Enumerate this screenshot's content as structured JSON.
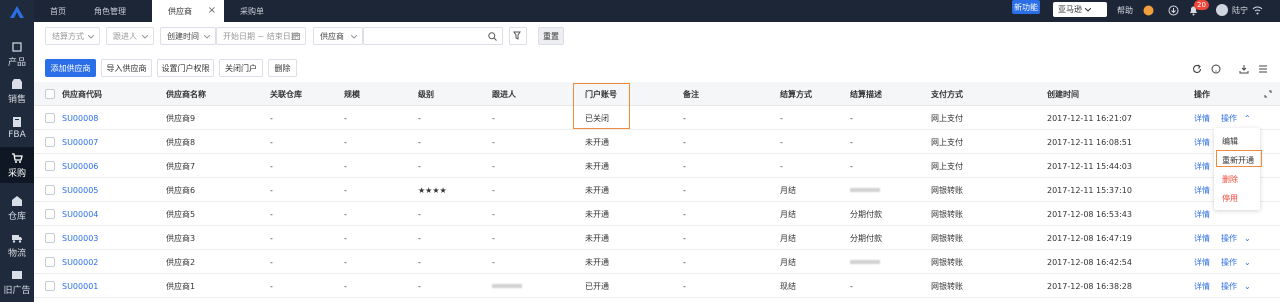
{
  "sidebar": {
    "items": [
      {
        "label": "产品",
        "icon": "cube-icon"
      },
      {
        "label": "销售",
        "icon": "store-icon"
      },
      {
        "label": "FBA",
        "icon": "box-icon"
      },
      {
        "label": "采购",
        "icon": "cart-icon"
      },
      {
        "label": "仓库",
        "icon": "warehouse-icon"
      },
      {
        "label": "物流",
        "icon": "truck-icon"
      },
      {
        "label": "旧广告",
        "icon": "ad-icon"
      }
    ]
  },
  "tabs": [
    {
      "label": "首页"
    },
    {
      "label": "角色管理"
    },
    {
      "label": "供应商",
      "close": "×"
    },
    {
      "label": "采购单"
    }
  ],
  "topbar": {
    "new_feature": "新功能",
    "region": "亚马逊",
    "help": "帮助",
    "notify_count": "20",
    "user": "陆宁"
  },
  "filters": {
    "settlement": "结算方式",
    "follower": "跟进人",
    "time_type": "创建时间",
    "date_range": "开始日期 ~ 结束日期",
    "search_field": "供应商",
    "search_value": "",
    "reset": "重置"
  },
  "actions": {
    "add": "添加供应商",
    "import": "导入供应商",
    "portal_perm": "设置门户权限",
    "close_portal": "关闭门户",
    "delete": "删除"
  },
  "columns": [
    "供应商代码",
    "供应商名称",
    "关联仓库",
    "规模",
    "级别",
    "跟进人",
    "门户账号",
    "备注",
    "结算方式",
    "结算描述",
    "支付方式",
    "创建时间",
    "操作"
  ],
  "rows": [
    {
      "code": "SU00008",
      "name": "供应商9",
      "warehouse": "-",
      "scale": "-",
      "level": "-",
      "follower": "-",
      "portal": "已关闭",
      "remark": "-",
      "settle": "-",
      "settle_desc": "-",
      "pay": "网上支付",
      "created": "2017-12-11 16:21:07",
      "detail": "详情",
      "op": "操作",
      "op_arrow": "⌃"
    },
    {
      "code": "SU00007",
      "name": "供应商8",
      "warehouse": "-",
      "scale": "-",
      "level": "-",
      "follower": "-",
      "portal": "未开通",
      "remark": "-",
      "settle": "-",
      "settle_desc": "-",
      "pay": "网上支付",
      "created": "2017-12-11 16:08:51",
      "detail": "详情",
      "op": "",
      "op_arrow": ""
    },
    {
      "code": "SU00006",
      "name": "供应商7",
      "warehouse": "-",
      "scale": "-",
      "level": "-",
      "follower": "-",
      "portal": "未开通",
      "remark": "-",
      "settle": "-",
      "settle_desc": "-",
      "pay": "网上支付",
      "created": "2017-12-11 15:44:03",
      "detail": "详情",
      "op": "",
      "op_arrow": ""
    },
    {
      "code": "SU00005",
      "name": "供应商6",
      "warehouse": "-",
      "scale": "-",
      "level": "★★★★",
      "follower": "-",
      "portal": "未开通",
      "remark": "-",
      "settle": "月结",
      "settle_desc": "",
      "pay": "网银转账",
      "created": "2017-12-11 15:37:10",
      "detail": "详情",
      "op": "",
      "op_arrow": ""
    },
    {
      "code": "SU00004",
      "name": "供应商5",
      "warehouse": "-",
      "scale": "-",
      "level": "-",
      "follower": "-",
      "portal": "未开通",
      "remark": "-",
      "settle": "月结",
      "settle_desc": "分期付款",
      "pay": "网银转账",
      "created": "2017-12-08 16:53:43",
      "detail": "详情",
      "op": "",
      "op_arrow": ""
    },
    {
      "code": "SU00003",
      "name": "供应商3",
      "warehouse": "-",
      "scale": "-",
      "level": "-",
      "follower": "-",
      "portal": "未开通",
      "remark": "-",
      "settle": "月结",
      "settle_desc": "分期付款",
      "pay": "网银转账",
      "created": "2017-12-08 16:47:19",
      "detail": "详情",
      "op": "操作",
      "op_arrow": "⌄"
    },
    {
      "code": "SU00002",
      "name": "供应商2",
      "warehouse": "-",
      "scale": "-",
      "level": "-",
      "follower": "-",
      "portal": "未开通",
      "remark": "-",
      "settle": "月结",
      "settle_desc": "",
      "pay": "网银转账",
      "created": "2017-12-08 16:42:54",
      "detail": "详情",
      "op": "操作",
      "op_arrow": "⌄"
    },
    {
      "code": "SU00001",
      "name": "供应商1",
      "warehouse": "-",
      "scale": "-",
      "level": "-",
      "follower": "",
      "portal": "已开通",
      "remark": "-",
      "settle": "现结",
      "settle_desc": "-",
      "pay": "网银转账",
      "created": "2017-12-08 16:38:28",
      "detail": "详情",
      "op": "操作",
      "op_arrow": "⌄"
    }
  ],
  "dropdown": {
    "items": [
      {
        "label": "编辑"
      },
      {
        "label": "重新开通"
      },
      {
        "label": "删除"
      },
      {
        "label": "停用"
      }
    ]
  },
  "colors": {
    "accent": "#2a6fe8",
    "sidebar": "#1f2a3c",
    "danger": "#f0453a",
    "highlight": "#f08a3c"
  }
}
